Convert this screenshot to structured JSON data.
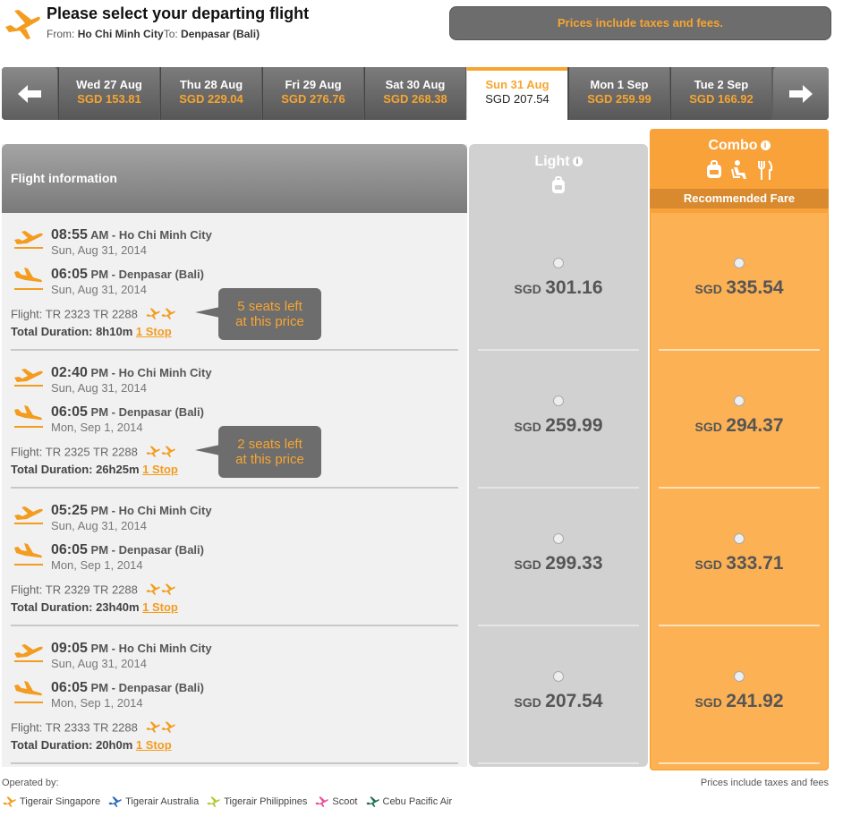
{
  "header": {
    "title": "Please select your departing flight",
    "from_label": "From:",
    "from_city": "Ho Chi Minh City",
    "to_label": "To:",
    "to_city": "Denpasar (Bali)",
    "tax_note": "Prices include taxes and fees."
  },
  "dates": [
    {
      "date": "Wed 27 Aug",
      "price": "SGD 153.81",
      "selected": false
    },
    {
      "date": "Thu 28 Aug",
      "price": "SGD 229.04",
      "selected": false
    },
    {
      "date": "Fri 29 Aug",
      "price": "SGD 276.76",
      "selected": false
    },
    {
      "date": "Sat 30 Aug",
      "price": "SGD 268.38",
      "selected": false
    },
    {
      "date": "Sun 31 Aug",
      "price": "SGD 207.54",
      "selected": true
    },
    {
      "date": "Mon 1 Sep",
      "price": "SGD 259.99",
      "selected": false
    },
    {
      "date": "Tue 2 Sep",
      "price": "SGD 166.92",
      "selected": false
    }
  ],
  "columns": {
    "info": "Flight information",
    "light": "Light",
    "combo": "Combo",
    "recommended": "Recommended Fare"
  },
  "flights": [
    {
      "dep_time": "08:55",
      "dep_ampm": "AM",
      "dep_city": "- Ho Chi Minh City",
      "dep_date": "Sun, Aug 31, 2014",
      "arr_time": "06:05",
      "arr_ampm": "PM",
      "arr_city": "- Denpasar (Bali)",
      "arr_date": "Sun, Aug 31, 2014",
      "flight": "Flight: TR 2323 TR 2288",
      "duration_label": "Total Duration: 8h10m",
      "stops": "1 Stop",
      "seats_line1": "5 seats left",
      "seats_line2": "at this price",
      "light_cur": "SGD",
      "light_price": "301.16",
      "combo_cur": "SGD",
      "combo_price": "335.54"
    },
    {
      "dep_time": "02:40",
      "dep_ampm": "PM",
      "dep_city": "- Ho Chi Minh City",
      "dep_date": "Sun, Aug 31, 2014",
      "arr_time": "06:05",
      "arr_ampm": "PM",
      "arr_city": "- Denpasar (Bali)",
      "arr_date": "Mon, Sep 1, 2014",
      "flight": "Flight: TR 2325 TR 2288",
      "duration_label": "Total Duration: 26h25m",
      "stops": "1 Stop",
      "seats_line1": "2 seats left",
      "seats_line2": "at this price",
      "light_cur": "SGD",
      "light_price": "259.99",
      "combo_cur": "SGD",
      "combo_price": "294.37"
    },
    {
      "dep_time": "05:25",
      "dep_ampm": "PM",
      "dep_city": "- Ho Chi Minh City",
      "dep_date": "Sun, Aug 31, 2014",
      "arr_time": "06:05",
      "arr_ampm": "PM",
      "arr_city": "- Denpasar (Bali)",
      "arr_date": "Mon, Sep 1, 2014",
      "flight": "Flight: TR 2329 TR 2288",
      "duration_label": "Total Duration: 23h40m",
      "stops": "1 Stop",
      "light_cur": "SGD",
      "light_price": "299.33",
      "combo_cur": "SGD",
      "combo_price": "333.71"
    },
    {
      "dep_time": "09:05",
      "dep_ampm": "PM",
      "dep_city": "- Ho Chi Minh City",
      "dep_date": "Sun, Aug 31, 2014",
      "arr_time": "06:05",
      "arr_ampm": "PM",
      "arr_city": "- Denpasar (Bali)",
      "arr_date": "Mon, Sep 1, 2014",
      "flight": "Flight: TR 2333 TR 2288",
      "duration_label": "Total Duration: 20h0m",
      "stops": "1 Stop",
      "light_cur": "SGD",
      "light_price": "207.54",
      "combo_cur": "SGD",
      "combo_price": "241.92"
    }
  ],
  "footer": {
    "operated_by": "Operated by:",
    "note": "Prices include taxes and fees",
    "airlines": [
      {
        "name": "Tigerair Singapore",
        "color": "#f39c1f"
      },
      {
        "name": "Tigerair Australia",
        "color": "#2a6ab8"
      },
      {
        "name": "Tigerair Philippines",
        "color": "#b4c832"
      },
      {
        "name": "Scoot",
        "color": "#e84e9a"
      },
      {
        "name": "Cebu Pacific Air",
        "color": "#1f6e55"
      }
    ]
  },
  "colors": {
    "accent": "#f7a531",
    "combo_bg": "#fcb154",
    "light_bg": "#d1d1d1"
  }
}
